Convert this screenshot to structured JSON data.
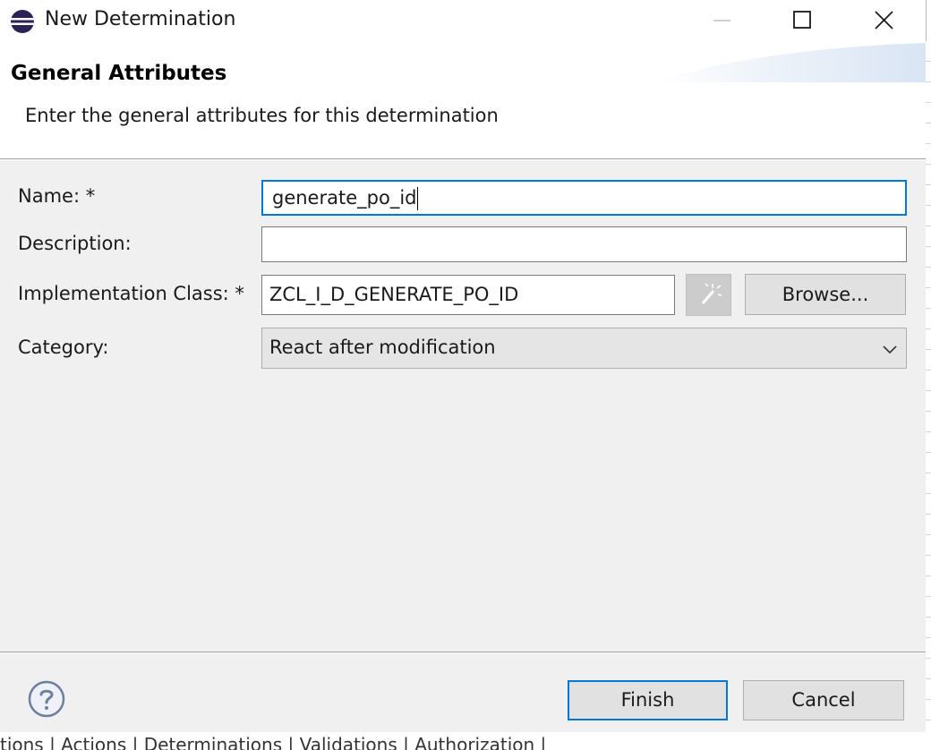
{
  "window": {
    "title": "New Determination",
    "app_icon": "eclipse-icon",
    "controls": {
      "minimize_icon": "minimize-icon",
      "maximize_icon": "maximize-icon",
      "close_icon": "close-icon"
    }
  },
  "header": {
    "title": "General Attributes",
    "description": "Enter the general attributes for this determination"
  },
  "form": {
    "name": {
      "label": "Name: *",
      "value": "generate_po_id"
    },
    "description": {
      "label": "Description:",
      "value": ""
    },
    "implementation_class": {
      "label": "Implementation Class: *",
      "value": "ZCL_I_D_GENERATE_PO_ID",
      "wand_icon": "magic-wand-icon",
      "browse_label": "Browse..."
    },
    "category": {
      "label": "Category:",
      "selected": "React after modification",
      "arrow_icon": "chevron-down-icon"
    }
  },
  "footer": {
    "help_icon": "help-icon",
    "finish_label": "Finish",
    "cancel_label": "Cancel"
  },
  "background_tabs": "tions | Actions | Determinations | Validations | Authorization |",
  "colors": {
    "focus_border": "#0078d7",
    "dialog_bg": "#f0f0f0",
    "button_bg": "#e1e1e1"
  }
}
